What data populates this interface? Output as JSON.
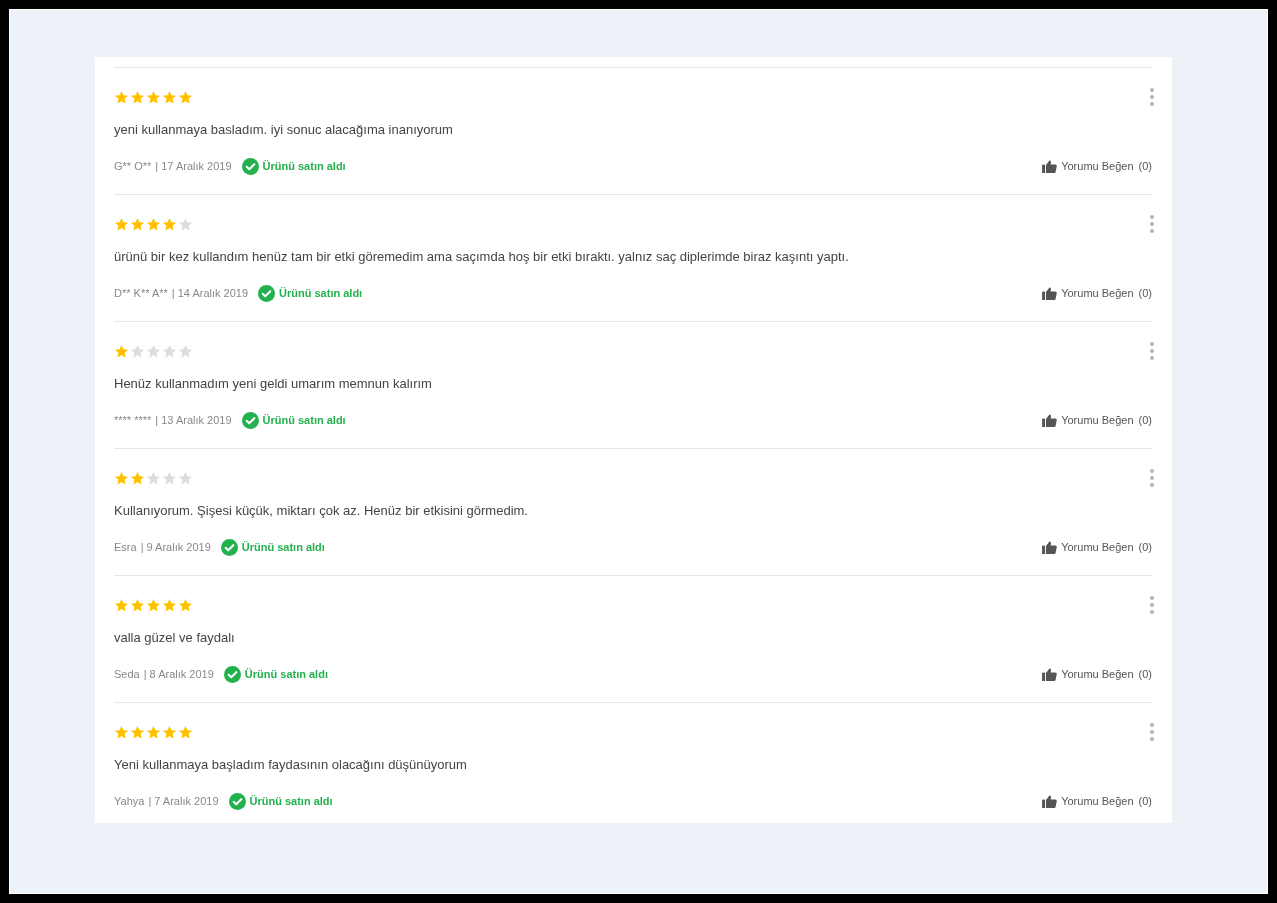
{
  "reviews": [
    {
      "stars": 5,
      "text": "yeni kullanmaya basladım. iyi sonuc alacağıma inanıyorum",
      "author": "G** O**",
      "date": "| 17 Aralık 2019",
      "verified": "Ürünü satın aldı",
      "like": "Yorumu Beğen",
      "like_count": "(0)"
    },
    {
      "stars": 4,
      "text": "ürünü bir kez kullandım henüz tam bir etki göremedim ama saçımda hoş bir etki bıraktı. yalnız saç diplerimde biraz kaşıntı yaptı.",
      "author": "D** K** A**",
      "date": "| 14 Aralık 2019",
      "verified": "Ürünü satın aldı",
      "like": "Yorumu Beğen",
      "like_count": "(0)"
    },
    {
      "stars": 1,
      "text": "Henüz kullanmadım yeni geldi umarım memnun kalırım",
      "author": "**** ****",
      "date": "| 13 Aralık 2019",
      "verified": "Ürünü satın aldı",
      "like": "Yorumu Beğen",
      "like_count": "(0)"
    },
    {
      "stars": 2,
      "text": "Kullanıyorum. Şişesi küçük, miktarı çok az. Henüz bir etkisini görmedim.",
      "author": "Esra",
      "date": "| 9 Aralık 2019",
      "verified": "Ürünü satın aldı",
      "like": "Yorumu Beğen",
      "like_count": "(0)"
    },
    {
      "stars": 5,
      "text": "valla güzel ve faydalı",
      "author": "Seda",
      "date": "| 8 Aralık 2019",
      "verified": "Ürünü satın aldı",
      "like": "Yorumu Beğen",
      "like_count": "(0)"
    },
    {
      "stars": 5,
      "text": "Yeni kullanmaya başladım faydasının olacağını düşünüyorum",
      "author": "Yahya",
      "date": "| 7 Aralık 2019",
      "verified": "Ürünü satın aldı",
      "like": "Yorumu Beğen",
      "like_count": "(0)"
    }
  ]
}
